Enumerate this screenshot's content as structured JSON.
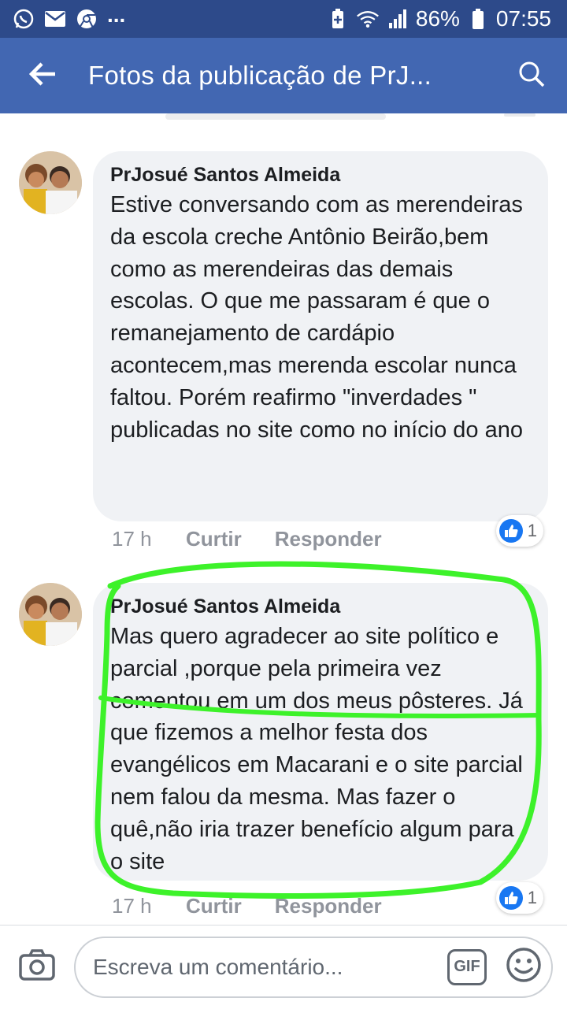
{
  "status_bar": {
    "battery_percent": "86%",
    "time": "07:55",
    "overflow_indicator": "..."
  },
  "app_bar": {
    "title": "Fotos da publicação de PrJ..."
  },
  "comments": [
    {
      "author": "PrJosué Santos Almeida",
      "text": "Estive conversando com as merendeiras da escola creche Antônio Beirão,bem como as merendeiras das demais escolas. O que me passaram é que o remanejamento de cardápio acontecem,mas merenda escolar nunca faltou. Porém reafirmo \"inverdades \" publicadas no site como no início do ano",
      "time": "17 h",
      "like_label": "Curtir",
      "reply_label": "Responder",
      "reaction_count": "1"
    },
    {
      "author": "PrJosué Santos Almeida",
      "text": "Mas quero agradecer ao site político e parcial ,porque pela primeira vez comentou em um dos meus pôsteres. Já que fizemos a melhor festa dos evangélicos em Macarani e o site parcial nem falou da mesma. Mas fazer o quê,não iria trazer benefício algum para o site",
      "time": "17 h",
      "like_label": "Curtir",
      "reply_label": "Responder",
      "reaction_count": "1"
    }
  ],
  "composer": {
    "placeholder": "Escreva um comentário...",
    "gif_label": "GIF"
  },
  "colors": {
    "status_bar": "#2d4a8a",
    "app_bar": "#4267b2",
    "bubble": "#f0f2f5",
    "like_blue": "#1877f2",
    "highlight": "#3df22a"
  },
  "icons": {
    "status_left": [
      "whatsapp-icon",
      "mail-icon",
      "chrome-icon"
    ],
    "status_right": [
      "battery-saver-icon",
      "wifi-icon",
      "signal-icon",
      "battery-icon"
    ],
    "app_bar": [
      "back-arrow-icon",
      "search-icon"
    ],
    "composer": [
      "camera-icon",
      "gif-icon",
      "emoji-icon"
    ]
  }
}
